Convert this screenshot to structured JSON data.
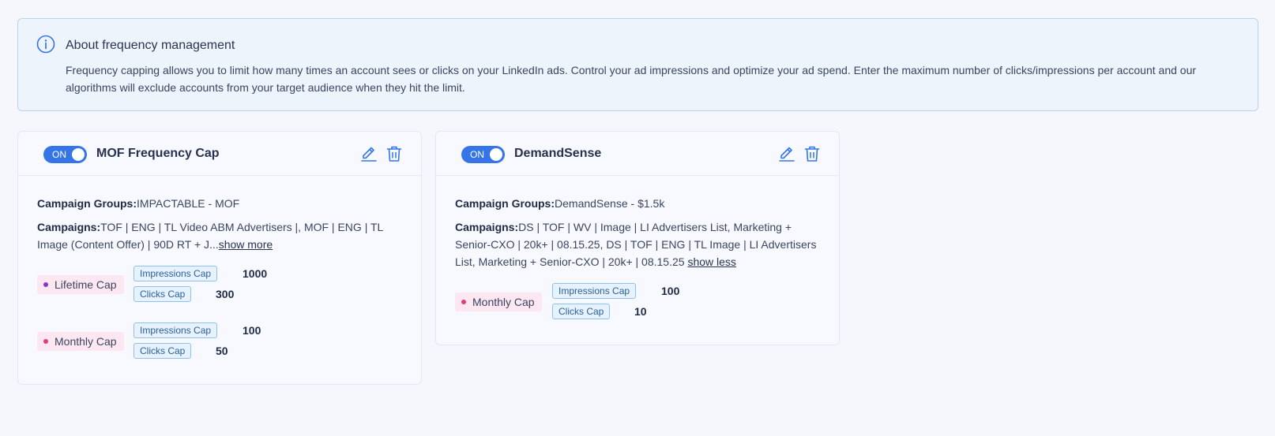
{
  "banner": {
    "icon": "info-icon",
    "title": "About frequency management",
    "text": "Frequency capping allows you to limit how many times an account sees or clicks on your LinkedIn ads. Control your ad impressions and optimize your ad spend. Enter the maximum number of clicks/impressions per account and our algorithms will exclude accounts from your target audience when they hit the limit."
  },
  "cards": [
    {
      "toggle": "ON",
      "title": "MOF Frequency Cap",
      "campaign_groups_label": "Campaign Groups:",
      "campaign_groups": "IMPACTABLE - MOF",
      "campaigns_label": "Campaigns:",
      "campaigns": "TOF | ENG | TL Video ABM Advertisers |, MOF | ENG | TL Image (Content Offer) | 90D RT + J...",
      "toggle_link": "show more",
      "caps": [
        {
          "name": "Lifetime Cap",
          "impressions_label": "Impressions Cap",
          "impressions": "1000",
          "clicks_label": "Clicks Cap",
          "clicks": "300"
        },
        {
          "name": "Monthly Cap",
          "impressions_label": "Impressions Cap",
          "impressions": "100",
          "clicks_label": "Clicks Cap",
          "clicks": "50"
        }
      ]
    },
    {
      "toggle": "ON",
      "title": "DemandSense",
      "campaign_groups_label": "Campaign Groups:",
      "campaign_groups": "DemandSense - $1.5k",
      "campaigns_label": "Campaigns:",
      "campaigns": "DS | TOF | WV | Image | LI Advertisers List, Marketing + Senior-CXO | 20k+ | 08.15.25, DS | TOF | ENG | TL Image | LI Advertisers List, Marketing + Senior-CXO | 20k+ | 08.15.25",
      "toggle_link": "show less",
      "caps": [
        {
          "name": "Monthly Cap",
          "impressions_label": "Impressions Cap",
          "impressions": "100",
          "clicks_label": "Clicks Cap",
          "clicks": "10"
        }
      ]
    }
  ],
  "colors": {
    "accent": "#3575e8",
    "lifetime_dot": "#8a34c9",
    "monthly_dot": "#e33b7c"
  }
}
